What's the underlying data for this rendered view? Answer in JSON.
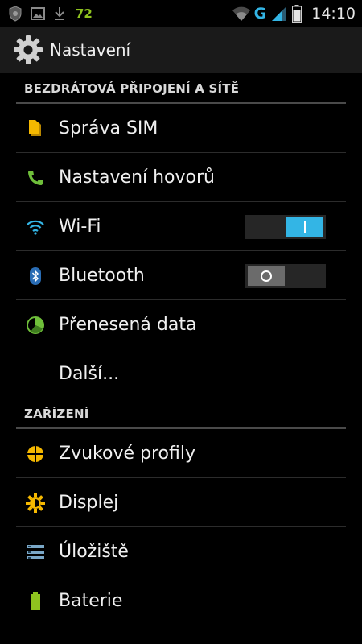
{
  "status_bar": {
    "battery_level": "72",
    "network_type": "G",
    "clock": "14:10"
  },
  "action_bar": {
    "title": "Nastavení",
    "icon": "gear-icon"
  },
  "sections": [
    {
      "header": "BEZDRÁTOVÁ PŘIPOJENÍ A SÍTĚ",
      "items": [
        {
          "label": "Správa SIM",
          "icon": "sim-card-icon"
        },
        {
          "label": "Nastavení hovorů",
          "icon": "phone-icon"
        },
        {
          "label": "Wi-Fi",
          "icon": "wifi-icon",
          "toggle": "on"
        },
        {
          "label": "Bluetooth",
          "icon": "bluetooth-icon",
          "toggle": "off"
        },
        {
          "label": "Přenesená data",
          "icon": "data-usage-icon"
        },
        {
          "label": "Další...",
          "icon": ""
        }
      ]
    },
    {
      "header": "ZAŘÍZENÍ",
      "items": [
        {
          "label": "Zvukové profily",
          "icon": "audio-profile-icon"
        },
        {
          "label": "Displej",
          "icon": "brightness-icon"
        },
        {
          "label": "Úložiště",
          "icon": "storage-icon"
        },
        {
          "label": "Baterie",
          "icon": "battery-icon"
        }
      ]
    }
  ],
  "colors": {
    "accent": "#33b5e5",
    "sim_icon": "#f5b800",
    "phone_icon": "#6fbf3a",
    "battery_icon": "#8fc31f",
    "battery_level_text": "#8fc31f"
  }
}
